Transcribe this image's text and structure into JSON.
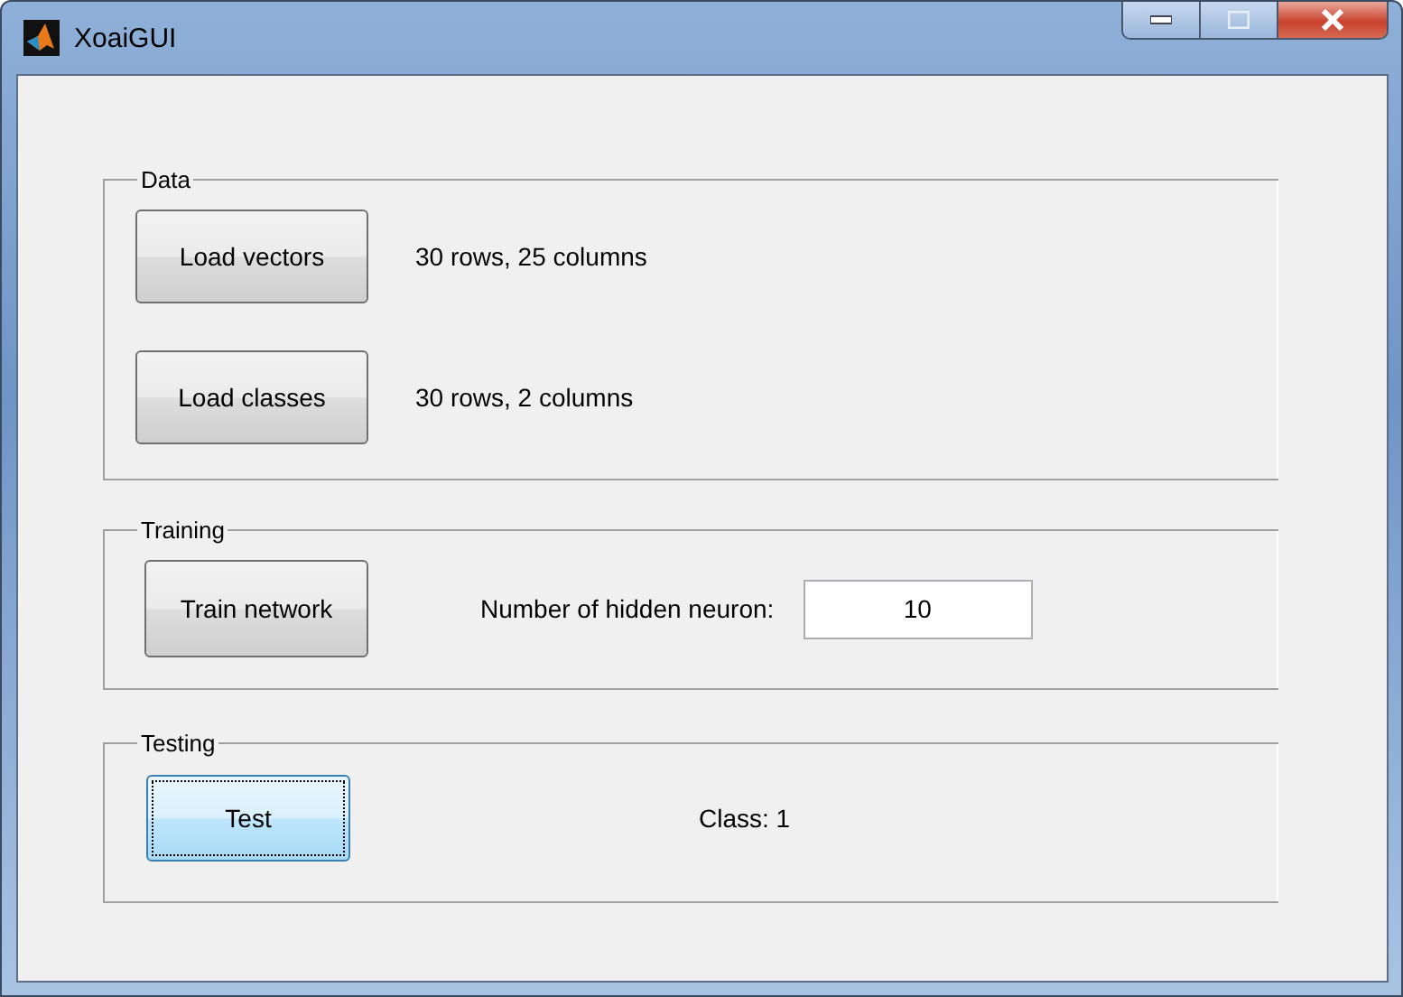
{
  "window": {
    "title": "XoaiGUI"
  },
  "panels": [
    {
      "title": "Data",
      "rows": [
        {
          "button": {
            "label": "Load vectors",
            "focused": false
          },
          "info": "30 rows, 25 columns"
        },
        {
          "button": {
            "label": "Load classes",
            "focused": false
          },
          "info": "30 rows, 2 columns"
        }
      ]
    },
    {
      "title": "Training",
      "rows": [
        {
          "button": {
            "label": "Train network",
            "focused": false
          },
          "field_label": "Number of hidden neuron:",
          "field_value": "10"
        }
      ]
    },
    {
      "title": "Testing",
      "rows": [
        {
          "button": {
            "label": "Test",
            "focused": true
          },
          "result": "Class: 1"
        }
      ]
    }
  ]
}
